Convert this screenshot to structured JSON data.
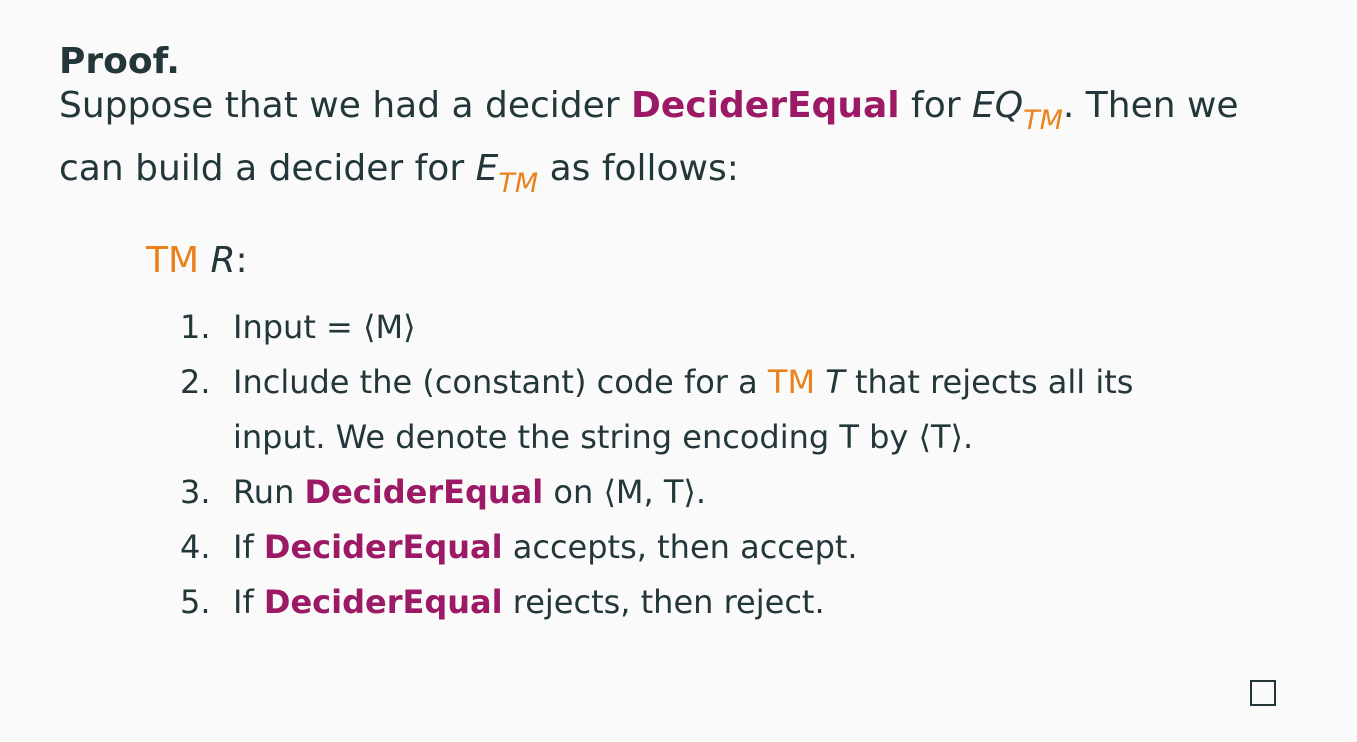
{
  "proof": {
    "heading": "Proof.",
    "line1": {
      "pre": "Suppose that we had a decider ",
      "decider": "DeciderEqual",
      "mid": " for ",
      "lang": "EQ",
      "lang_sub": "TM",
      "post": ". Then we"
    },
    "line2": {
      "pre": "can build a decider for ",
      "lang": "E",
      "lang_sub": "TM",
      "post": " as follows:"
    }
  },
  "machine": {
    "tm_label": "TM",
    "name": "R",
    "colon": ":"
  },
  "steps": [
    {
      "num": "1.",
      "text": "Input = ⟨M⟩"
    },
    {
      "num": "2.",
      "pre": "Include the (constant) code for a ",
      "tm": "TM",
      "mid": " ",
      "var": "T",
      "post": " that rejects all its",
      "line2": "input. We denote the string encoding T by ⟨T⟩."
    },
    {
      "num": "3.",
      "pre": "Run ",
      "decider": "DeciderEqual",
      "post": " on ⟨M, T⟩."
    },
    {
      "num": "4.",
      "pre": "If ",
      "decider": "DeciderEqual",
      "post": " accepts, then accept."
    },
    {
      "num": "5.",
      "pre": "If ",
      "decider": "DeciderEqual",
      "post": " rejects, then reject."
    }
  ],
  "colors": {
    "text": "#23373b",
    "alert": "#9c1a65",
    "orange": "#eb811b",
    "background": "#fafafa"
  },
  "qed_symbol": "qed-square"
}
